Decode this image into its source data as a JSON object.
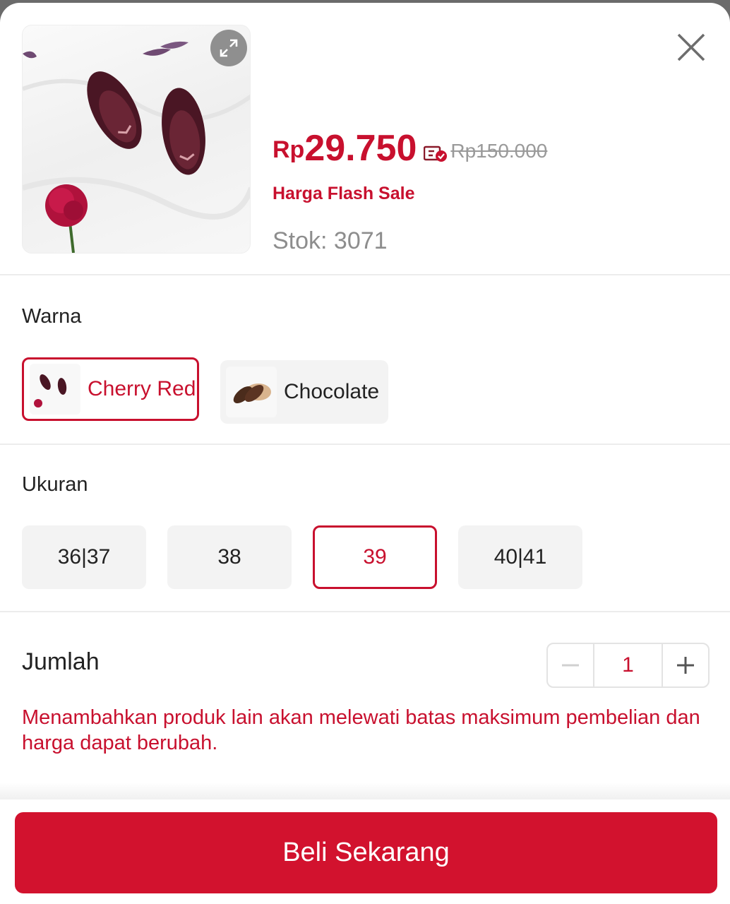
{
  "product": {
    "price_currency": "Rp",
    "price_value": "29.750",
    "original_price": "Rp150.000",
    "price_label": "Harga Flash Sale",
    "stock": "Stok: 3071"
  },
  "variants": {
    "color_title": "Warna",
    "colors": [
      {
        "label": "Cherry Red",
        "selected": true
      },
      {
        "label": "Chocolate",
        "selected": false
      }
    ],
    "size_title": "Ukuran",
    "sizes": [
      {
        "label": "36|37",
        "selected": false
      },
      {
        "label": "38",
        "selected": false
      },
      {
        "label": "39",
        "selected": true
      },
      {
        "label": "40|41",
        "selected": false
      }
    ]
  },
  "quantity": {
    "title": "Jumlah",
    "value": "1",
    "decrement_icon": "minus-icon",
    "increment_icon": "plus-icon"
  },
  "warning_text": "Menambahkan produk lain akan melewati batas maksimum pembelian dan harga dapat berubah.",
  "buy_button_label": "Beli Sekarang",
  "colors": {
    "accent": "#c8102e",
    "button": "#d2122e"
  }
}
